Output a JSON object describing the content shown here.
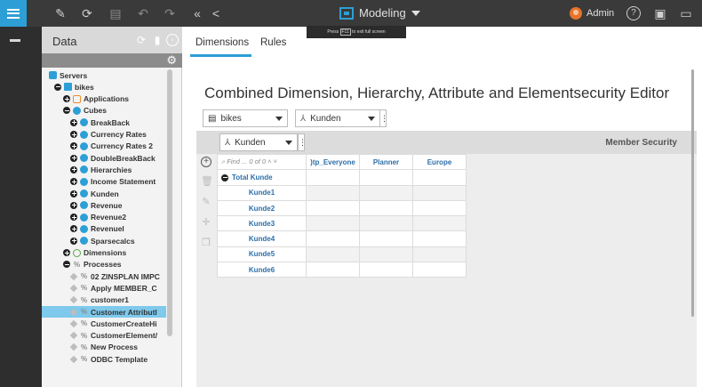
{
  "topbar": {
    "mode_label": "Modeling",
    "fullscreen_tip_prefix": "Press",
    "fullscreen_tip_key": "F11",
    "fullscreen_tip_suffix": "to exit full screen",
    "user_label": "Admin",
    "icons": [
      "pencil-icon",
      "refresh-icon",
      "save-icon",
      "undo-icon",
      "redo-icon",
      "double-left-icon",
      "share-icon",
      "help-icon",
      "window-icon",
      "chat-icon"
    ]
  },
  "data_panel": {
    "title": "Data",
    "tree": [
      {
        "label": "Servers",
        "level": 0,
        "icon": "server",
        "toggle": "none"
      },
      {
        "label": "bikes",
        "level": 1,
        "icon": "db",
        "toggle": "minus"
      },
      {
        "label": "Applications",
        "level": 2,
        "icon": "app",
        "toggle": "plus"
      },
      {
        "label": "Cubes",
        "level": 2,
        "icon": "cube",
        "toggle": "minus"
      },
      {
        "label": "BreakBack",
        "level": 3,
        "icon": "cube",
        "toggle": "plus"
      },
      {
        "label": "Currency Rates",
        "level": 3,
        "icon": "cube",
        "toggle": "plus"
      },
      {
        "label": "Currency Rates 2",
        "level": 3,
        "icon": "cube",
        "toggle": "plus"
      },
      {
        "label": "DoubleBreakBack",
        "level": 3,
        "icon": "cube",
        "toggle": "plus"
      },
      {
        "label": "Hierarchies",
        "level": 3,
        "icon": "cube",
        "toggle": "plus"
      },
      {
        "label": "Income Statement",
        "level": 3,
        "icon": "cube",
        "toggle": "plus"
      },
      {
        "label": "Kunden",
        "level": 3,
        "icon": "cube",
        "toggle": "plus"
      },
      {
        "label": "Revenue",
        "level": 3,
        "icon": "cube",
        "toggle": "plus"
      },
      {
        "label": "Revenue2",
        "level": 3,
        "icon": "cube",
        "toggle": "plus"
      },
      {
        "label": "Revenuel",
        "level": 3,
        "icon": "cube",
        "toggle": "plus"
      },
      {
        "label": "Sparsecalcs",
        "level": 3,
        "icon": "cube",
        "toggle": "plus"
      },
      {
        "label": "Dimensions",
        "level": 2,
        "icon": "dim",
        "toggle": "plus"
      },
      {
        "label": "Processes",
        "level": 2,
        "icon": "proc",
        "toggle": "minus"
      },
      {
        "label": "02 ZINSPLAN IMPC",
        "level": 3,
        "icon": "proc",
        "toggle": "dot"
      },
      {
        "label": "Apply MEMBER_C",
        "level": 3,
        "icon": "proc",
        "toggle": "dot"
      },
      {
        "label": "customer1",
        "level": 3,
        "icon": "proc",
        "toggle": "dot"
      },
      {
        "label": "Customer Attributl",
        "level": 3,
        "icon": "proc",
        "toggle": "dot",
        "selected": true
      },
      {
        "label": "CustomerCreateHi",
        "level": 3,
        "icon": "proc",
        "toggle": "dot"
      },
      {
        "label": "CustomerElement/",
        "level": 3,
        "icon": "proc",
        "toggle": "dot"
      },
      {
        "label": "New Process",
        "level": 3,
        "icon": "proc",
        "toggle": "dot"
      },
      {
        "label": "ODBC Template",
        "level": 3,
        "icon": "proc",
        "toggle": "dot"
      }
    ]
  },
  "main": {
    "tabs": [
      {
        "label": "Dimensions"
      },
      {
        "label": "Rules"
      }
    ],
    "title": "Combined Dimension, Hierarchy, Attribute and Elementsecurity Editor",
    "server_select": "bikes",
    "dimension_select": "Kunden",
    "hierarchy_select": "Kunden",
    "find_placeholder": "Find ...",
    "find_count": "0 of 0",
    "member_security_label": "Member Security",
    "columns": [
      ")tp_Everyone",
      "Planner",
      "Europe"
    ],
    "rows": [
      {
        "label": "Total Kunde",
        "total": true
      },
      {
        "label": "Kunde1"
      },
      {
        "label": "Kunde2"
      },
      {
        "label": "Kunde3"
      },
      {
        "label": "Kunde4"
      },
      {
        "label": "Kunde5"
      },
      {
        "label": "Kunde6"
      }
    ]
  }
}
